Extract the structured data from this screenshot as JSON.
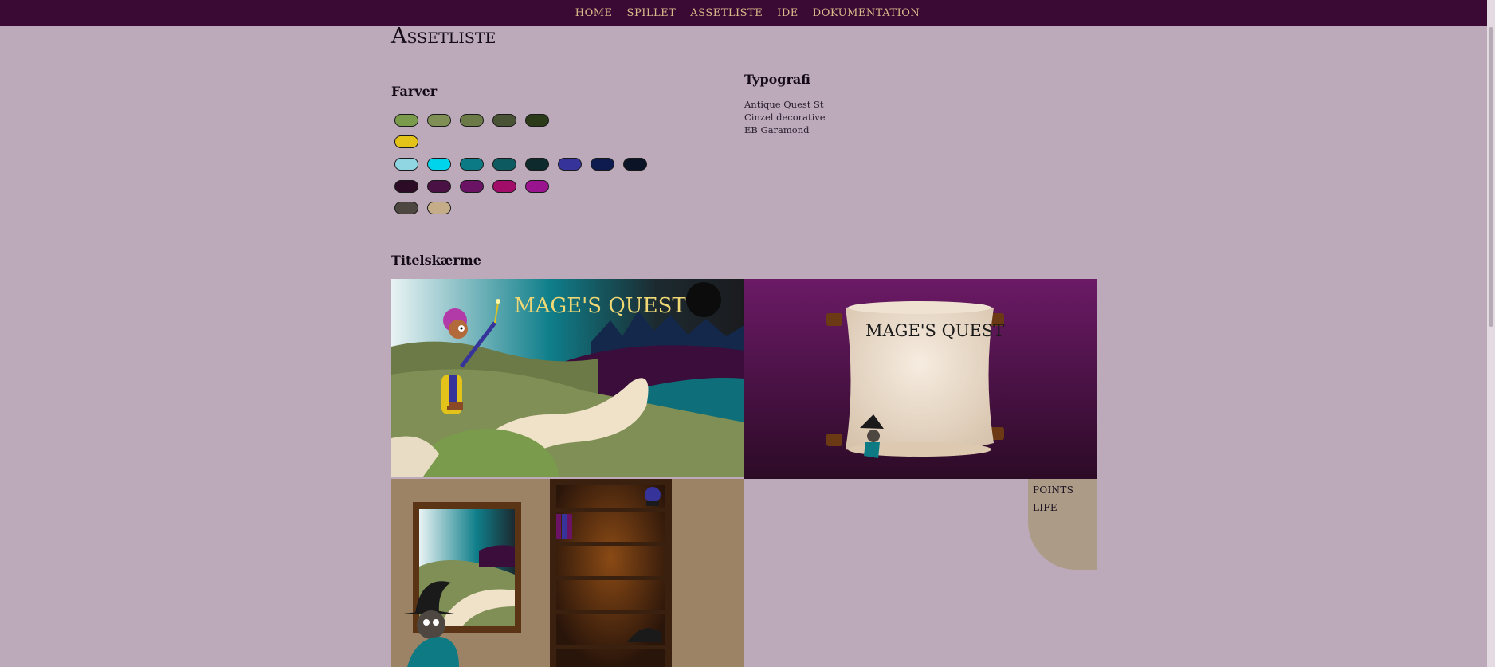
{
  "nav": {
    "links": [
      "HOME",
      "SPILLET",
      "ASSETLISTE",
      "IDE",
      "DOKUMENTATION"
    ]
  },
  "page": {
    "title": "Assetliste"
  },
  "colors": {
    "heading": "Farver",
    "rows": [
      [
        "#7a9a4c",
        "#7f8f55",
        "#6b7a46",
        "#4a5236",
        "#2b3a18"
      ],
      [
        "#e3c21a"
      ],
      [
        "#8fd6e2",
        "#00d4ec",
        "#0b7a84",
        "#0d5a60",
        "#0e2a2c",
        "#36349a",
        "#0d1b4e",
        "#0b1426"
      ],
      [
        "#2c0b26",
        "#4a1144",
        "#6a1264",
        "#a30d6a",
        "#9a1490"
      ],
      [
        "#4e4640",
        "#c6ad8a"
      ]
    ]
  },
  "typography": {
    "heading": "Typografi",
    "fonts": [
      "Antique Quest St",
      "Cinzel decorative",
      "EB Garamond"
    ]
  },
  "title_screens": {
    "heading": "Titelskærme",
    "screen1": {
      "logo": "MAGE'S QUEST"
    },
    "screen2": {
      "logo": "MAGE'S QUEST"
    },
    "screen4": {
      "points_label": "POINTS",
      "life_label": "LIFE"
    }
  }
}
